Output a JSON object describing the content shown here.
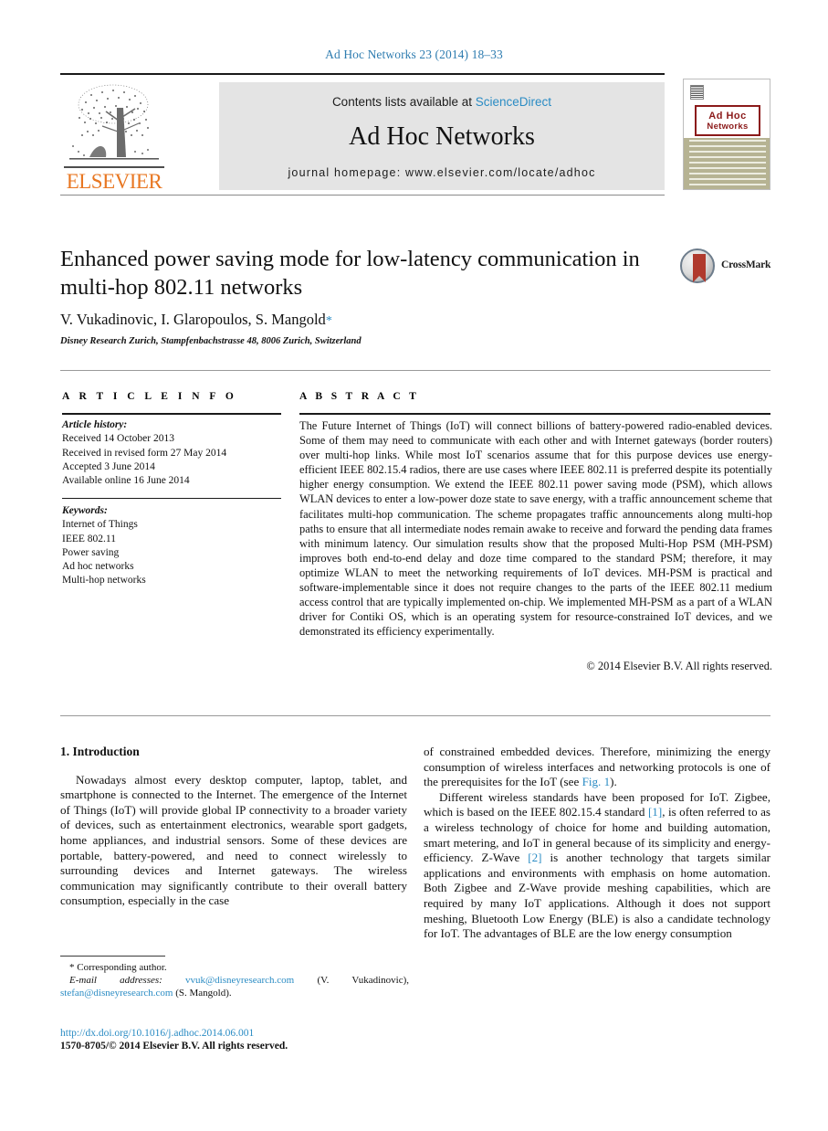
{
  "running_head": "Ad Hoc Networks 23 (2014) 18–33",
  "banner": {
    "contents_prefix": "Contents lists available at ",
    "sciencedirect": "ScienceDirect",
    "journal_title": "Ad Hoc Networks",
    "homepage": "journal homepage: www.elsevier.com/locate/adhoc",
    "publisher": "ELSEVIER",
    "cover_title_line1": "Ad Hoc",
    "cover_title_line2": "Networks"
  },
  "article": {
    "title": "Enhanced power saving mode for low-latency communication in multi-hop 802.11 networks",
    "authors": "V. Vukadinovic, I. Glaropoulos, S. Mangold",
    "author_star": "*",
    "affiliation": "Disney Research Zurich, Stampfenbachstrasse 48, 8006 Zurich, Switzerland",
    "crossmark_label": "CrossMark"
  },
  "info": {
    "heading": "A R T I C L E   I N F O",
    "history_label": "Article history:",
    "history": [
      "Received 14 October 2013",
      "Received in revised form 27 May 2014",
      "Accepted 3 June 2014",
      "Available online 16 June 2014"
    ],
    "keywords_label": "Keywords:",
    "keywords": [
      "Internet of Things",
      "IEEE 802.11",
      "Power saving",
      "Ad hoc networks",
      "Multi-hop networks"
    ]
  },
  "abstract": {
    "heading": "A B S T R A C T",
    "text": "The Future Internet of Things (IoT) will connect billions of battery-powered radio-enabled devices. Some of them may need to communicate with each other and with Internet gateways (border routers) over multi-hop links. While most IoT scenarios assume that for this purpose devices use energy-efficient IEEE 802.15.4 radios, there are use cases where IEEE 802.11 is preferred despite its potentially higher energy consumption. We extend the IEEE 802.11 power saving mode (PSM), which allows WLAN devices to enter a low-power doze state to save energy, with a traffic announcement scheme that facilitates multi-hop communication. The scheme propagates traffic announcements along multi-hop paths to ensure that all intermediate nodes remain awake to receive and forward the pending data frames with minimum latency. Our simulation results show that the proposed Multi-Hop PSM (MH-PSM) improves both end-to-end delay and doze time compared to the standard PSM; therefore, it may optimize WLAN to meet the networking requirements of IoT devices. MH-PSM is practical and software-implementable since it does not require changes to the parts of the IEEE 802.11 medium access control that are typically implemented on-chip. We implemented MH-PSM as a part of a WLAN driver for Contiki OS, which is an operating system for resource-constrained IoT devices, and we demonstrated its efficiency experimentally.",
    "copyright": "© 2014 Elsevier B.V. All rights reserved."
  },
  "body": {
    "section_heading": "1. Introduction",
    "left_paragraph": "Nowadays almost every desktop computer, laptop, tablet, and smartphone is connected to the Internet. The emergence of the Internet of Things (IoT) will provide global IP connectivity to a broader variety of devices, such as entertainment electronics, wearable sport gadgets, home appliances, and industrial sensors. Some of these devices are portable, battery-powered, and need to connect wirelessly to surrounding devices and Internet gateways. The wireless communication may significantly contribute to their overall battery consumption, especially in the case",
    "right_paragraph_1_a": "of constrained embedded devices. Therefore, minimizing the energy consumption of wireless interfaces and networking protocols is one of the prerequisites for the IoT (see ",
    "right_fig_ref": "Fig. 1",
    "right_paragraph_1_b": ").",
    "right_paragraph_2_a": "Different wireless standards have been proposed for IoT. Zigbee, which is based on the IEEE 802.15.4 standard ",
    "ref_1": "[1]",
    "right_paragraph_2_b": ", is often referred to as a wireless technology of choice for home and building automation, smart metering, and IoT in general because of its simplicity and energy-efficiency. Z-Wave ",
    "ref_2": "[2]",
    "right_paragraph_2_c": " is another technology that targets similar applications and environments with emphasis on home automation. Both Zigbee and Z-Wave provide meshing capabilities, which are required by many IoT applications. Although it does not support meshing, Bluetooth Low Energy (BLE) is also a candidate technology for IoT. The advantages of BLE are the low energy consumption"
  },
  "footnote": {
    "corresponding": "* Corresponding author.",
    "email_label": "E-mail addresses:",
    "email_1": "vvuk@disneyresearch.com",
    "email_1_name": " (V. Vukadinovic), ",
    "email_2": "stefan@disneyresearch.com",
    "email_2_name": " (S. Mangold)."
  },
  "footer": {
    "doi": "http://dx.doi.org/10.1016/j.adhoc.2014.06.001",
    "issn": "1570-8705/© 2014 Elsevier B.V. All rights reserved."
  },
  "colors": {
    "link": "#2b8cc4",
    "elsevier_orange": "#e87722",
    "cover_olive": "#b6b393",
    "crossmark_red": "#b03a2e"
  }
}
